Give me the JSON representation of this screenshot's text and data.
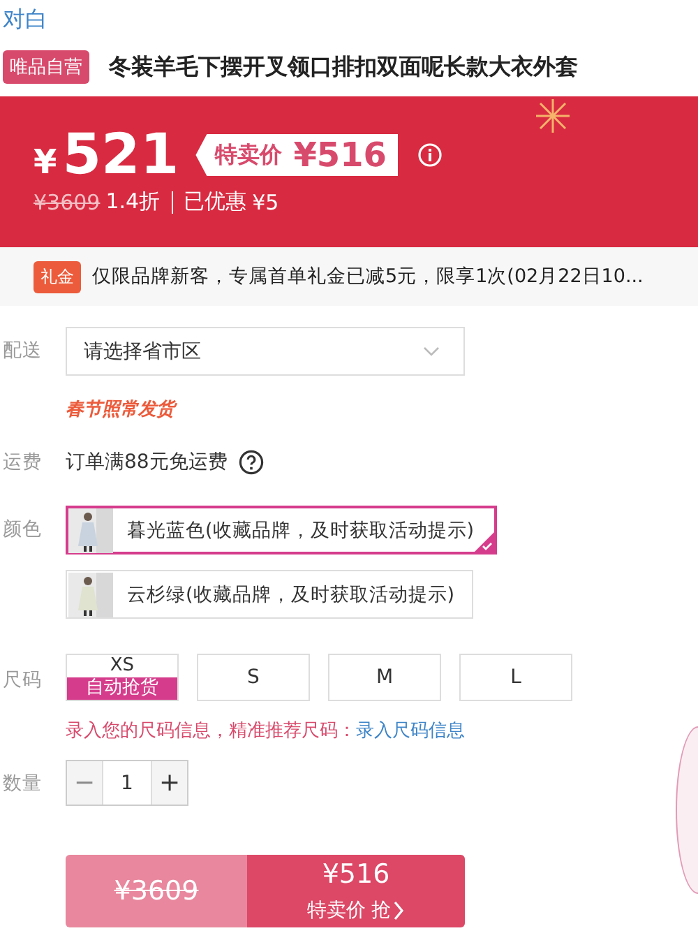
{
  "brand": "对白",
  "title": {
    "badge": "唯品自营",
    "text": "冬装羊毛下摆开叉领口排扣双面呢长款大衣外套"
  },
  "price": {
    "currency": "¥",
    "amount": "521",
    "special_label": "特卖价",
    "special_price": "¥516",
    "original": "¥3609",
    "discount": "1.4折",
    "saved_label": "已优惠",
    "saved": "¥5"
  },
  "gift": {
    "badge": "礼金",
    "text": "仅限品牌新客，专属首单礼金已减5元，限享1次(02月22日10..."
  },
  "delivery": {
    "label": "配送",
    "placeholder": "请选择省市区",
    "notice": "春节照常发货"
  },
  "shipping": {
    "label": "运费",
    "text": "订单满88元免运费"
  },
  "colors": {
    "label": "颜色",
    "options": [
      {
        "name": "暮光蓝色(收藏品牌，及时获取活动提示)",
        "selected": true
      },
      {
        "name": "云杉绿(收藏品牌，及时获取活动提示)",
        "selected": false
      }
    ]
  },
  "sizes": {
    "label": "尺码",
    "options": [
      {
        "name": "XS",
        "tag": "自动抢货",
        "selected": false
      },
      {
        "name": "S",
        "selected": false
      },
      {
        "name": "M",
        "selected": false
      },
      {
        "name": "L",
        "selected": false
      }
    ],
    "hint": "录入您的尺码信息，精准推荐尺码：",
    "link": "录入尺码信息"
  },
  "quantity": {
    "label": "数量",
    "minus": "−",
    "value": "1",
    "plus": "+",
    "minus_disabled": true
  },
  "buy": {
    "original": "¥3609",
    "price": "¥516",
    "action": "特卖价 抢"
  }
}
